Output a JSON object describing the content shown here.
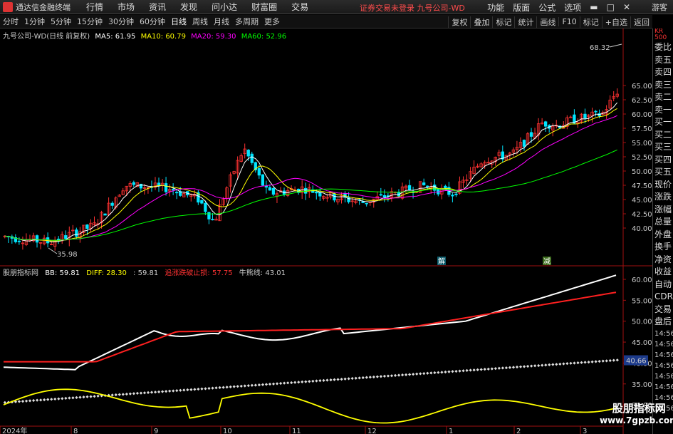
{
  "titlebar": {
    "app_title": "通达信金融终端",
    "menus": [
      "行情",
      "市场",
      "资讯",
      "发现",
      "问小达",
      "财富圈",
      "交易"
    ],
    "center_text": "证券交易未登录  九号公司-WD",
    "right_menus": [
      "功能",
      "版面",
      "公式",
      "选项"
    ],
    "guest": "游客"
  },
  "periods": [
    "分时",
    "1分钟",
    "5分钟",
    "15分钟",
    "30分钟",
    "60分钟",
    "日线",
    "周线",
    "月线",
    "多周期",
    "更多"
  ],
  "active_period": "日线",
  "toolbar": [
    "复权",
    "叠加",
    "标记",
    "统计",
    "画线",
    "F10",
    "标记",
    "+自选",
    "返回"
  ],
  "legend": {
    "name": "九号公司-WD(日线 前复权)",
    "ma5": "MA5: 61.95",
    "ma10": "MA10: 60.79",
    "ma20": "MA20: 59.30",
    "ma60": "MA60: 52.96"
  },
  "sub_legend": {
    "name": "股朋指标网",
    "bb": "BB: 59.81",
    "diff": "DIFF: 28.30",
    "diff2": ": 59.81",
    "stop": "追涨跌破止损: 57.75",
    "bull": "牛熊线: 43.01"
  },
  "annotations": {
    "high": "68.32",
    "low": "35.98",
    "marker1": "解",
    "marker2": "减"
  },
  "main_axis": [
    "65.00",
    "62.50",
    "60.00",
    "57.50",
    "55.00",
    "52.50",
    "50.00",
    "47.50",
    "45.00",
    "42.50",
    "40.00"
  ],
  "sub_axis": [
    "60.00",
    "55.00",
    "50.00",
    "45.00",
    "40.00",
    "35.00",
    "30.00"
  ],
  "sub_current": "40.66",
  "x_labels": [
    "2024年",
    "8",
    "9",
    "10",
    "11",
    "12",
    "1",
    "2",
    "3"
  ],
  "right_panel": {
    "top": "KR 500",
    "items": [
      "委比",
      "卖五",
      "卖四",
      "卖三",
      "卖二",
      "卖一",
      "买一",
      "买二",
      "买三",
      "买四",
      "买五",
      "现价",
      "涨跌",
      "涨幅",
      "总量",
      "外盘",
      "换手",
      "净资",
      "收益",
      "自动",
      "CDR",
      "交易",
      "盘后"
    ],
    "times": [
      "14:56",
      "14:56",
      "14:56",
      "14:56",
      "14:56",
      "14:56",
      "14:56",
      "14:56"
    ]
  },
  "watermark": {
    "line1": "股朋指标网",
    "line2": "www.7gpzb.com"
  },
  "colors": {
    "up": "#ff3232",
    "down": "#00e5ff",
    "ma5": "#ffffff",
    "ma10": "#ffff00",
    "ma20": "#ff00ff",
    "ma60": "#00ff00",
    "axis": "#a01010"
  }
}
